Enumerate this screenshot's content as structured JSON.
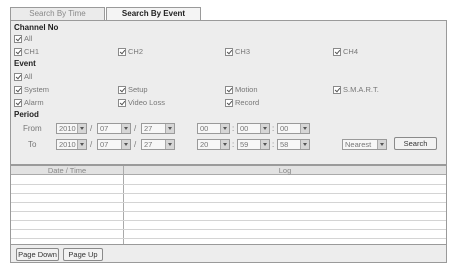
{
  "tabs": [
    {
      "label": "Search By Time",
      "active": false
    },
    {
      "label": "Search By Event",
      "active": true
    }
  ],
  "channel": {
    "title": "Channel No",
    "all_label": "All",
    "items": [
      "CH1",
      "CH2",
      "CH3",
      "CH4"
    ]
  },
  "event": {
    "title": "Event",
    "all_label": "All",
    "items": [
      "System",
      "Setup",
      "Motion",
      "S.M.A.R.T.",
      "Alarm",
      "Video Loss",
      "Record"
    ]
  },
  "period": {
    "title": "Period",
    "from_label": "From",
    "to_label": "To",
    "separator": "/",
    "time_separator": ":",
    "from": {
      "year": "2010",
      "month": "07",
      "day": "27",
      "hour": "00",
      "minute": "00",
      "second": "00"
    },
    "to": {
      "year": "2010",
      "month": "07",
      "day": "27",
      "hour": "20",
      "minute": "59",
      "second": "58"
    },
    "mode": "Nearest",
    "search_label": "Search"
  },
  "table": {
    "columns": [
      "Date / Time",
      "Log"
    ],
    "rows": []
  },
  "footer": {
    "page_down": "Page Down",
    "page_up": "Page Up"
  }
}
